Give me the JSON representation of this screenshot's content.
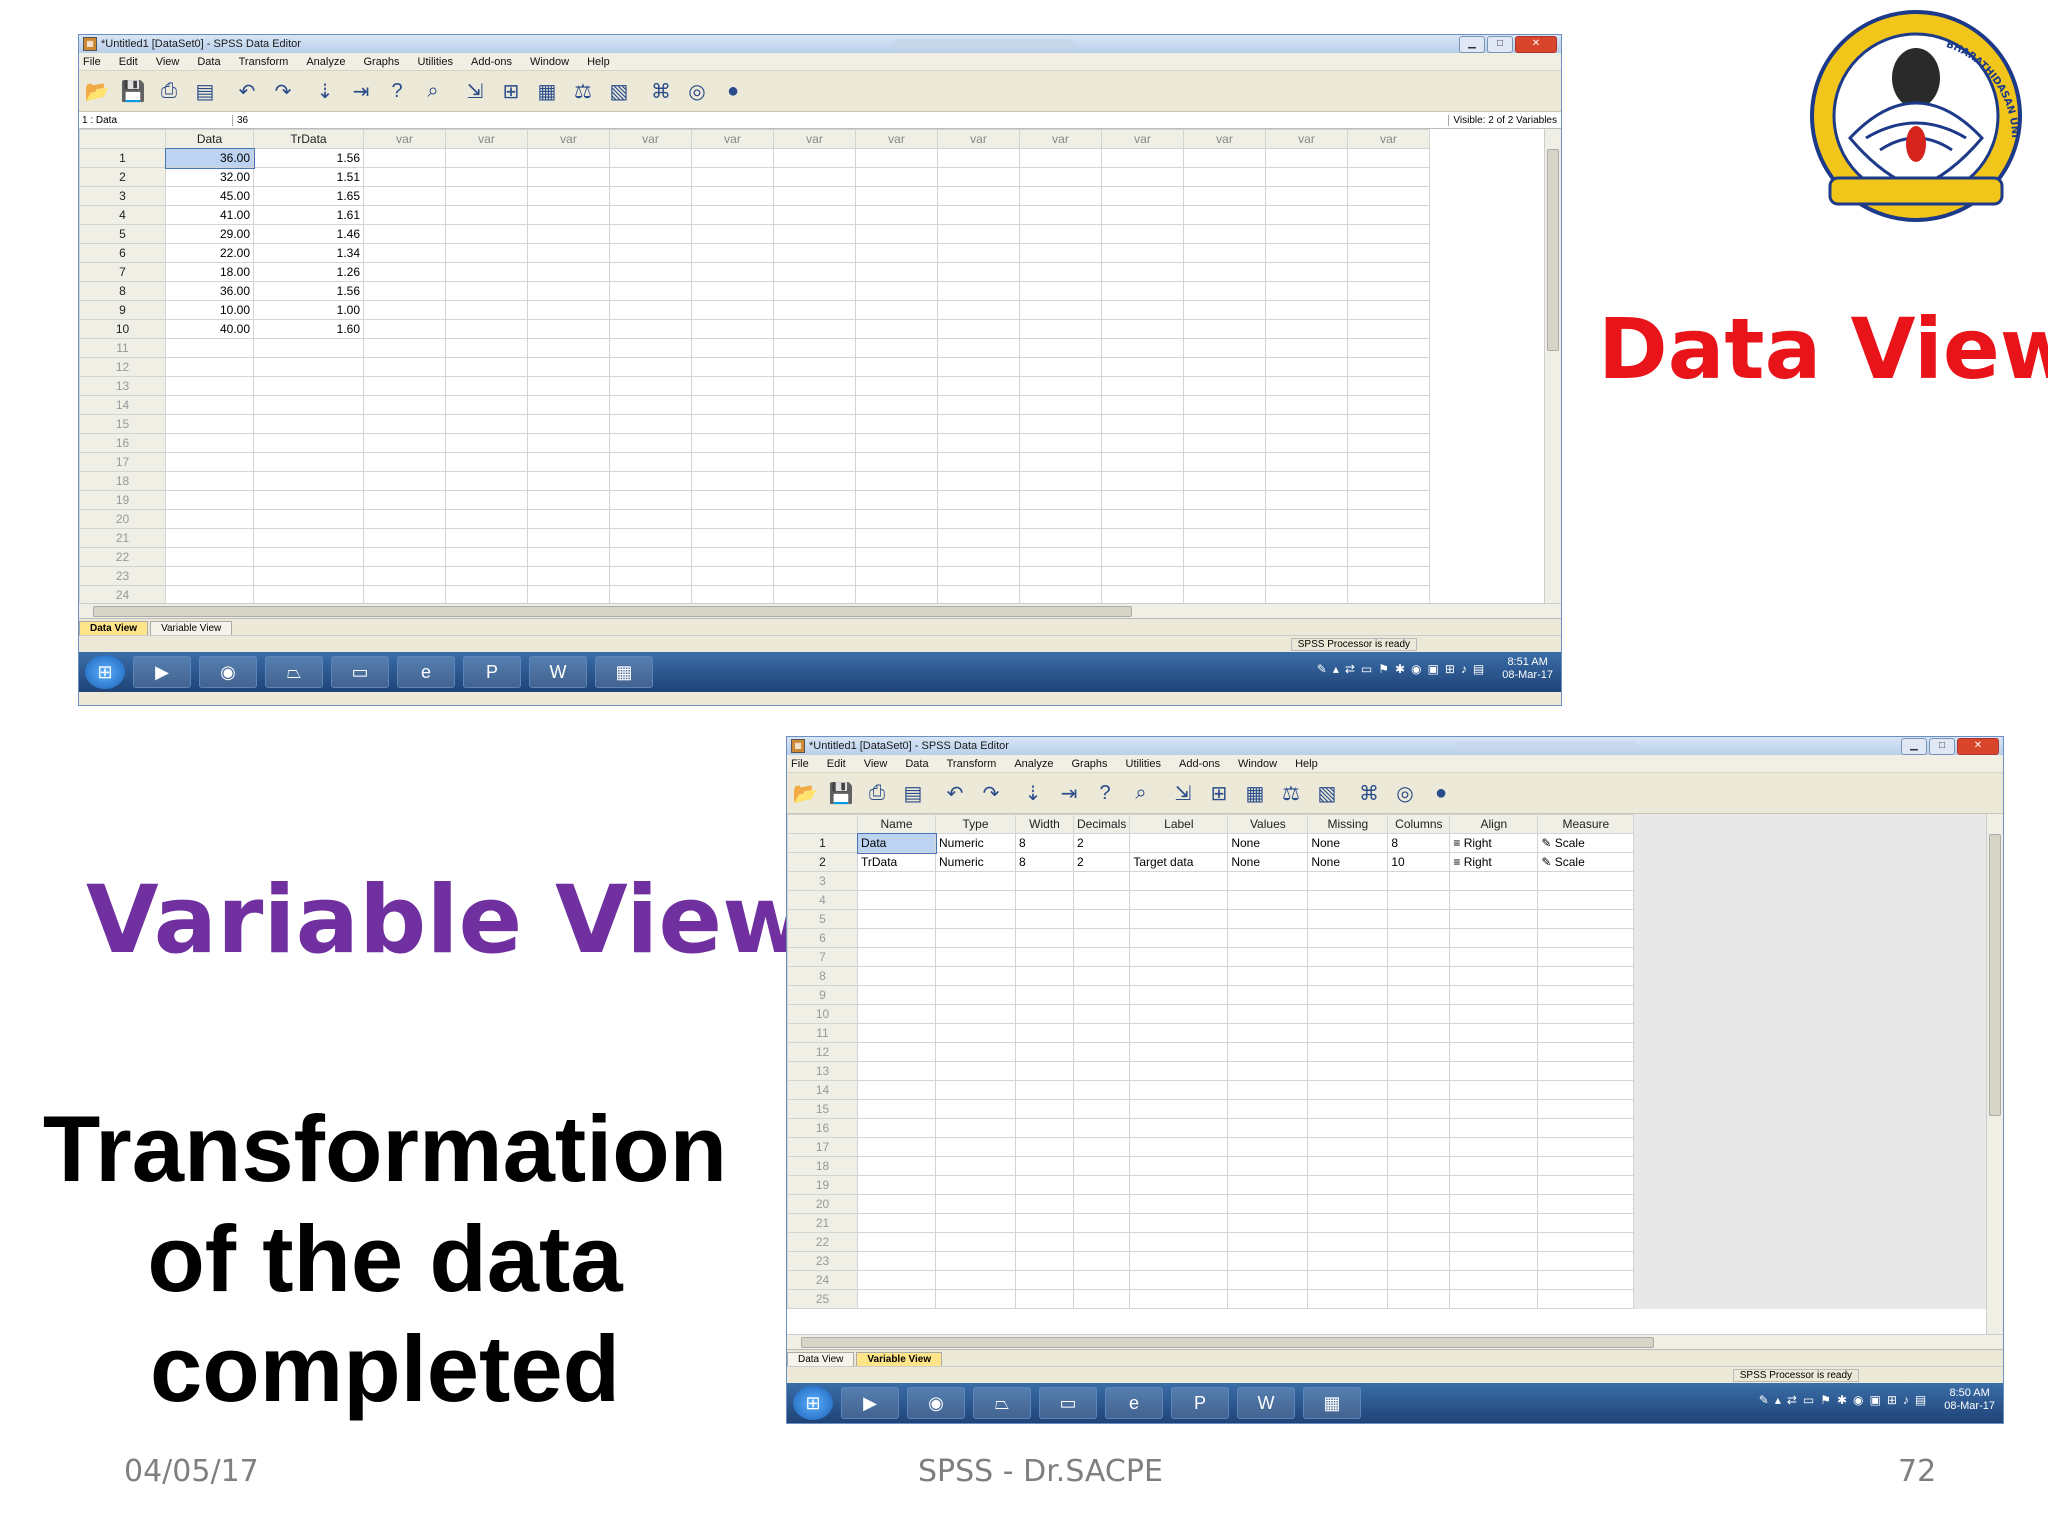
{
  "slide": {
    "data_view_heading": "Data View",
    "variable_view_heading": "Variable View",
    "transform_lines": [
      "Transformation",
      "of the data",
      "completed"
    ],
    "footer_date": "04/05/17",
    "footer_center": "SPSS - Dr.SACPE",
    "footer_page": "72",
    "logo_text": "BHARATHIDASAN UNIVERSITY"
  },
  "window1": {
    "title": "*Untitled1 [DataSet0] - SPSS Data Editor",
    "menu": [
      "File",
      "Edit",
      "View",
      "Data",
      "Transform",
      "Analyze",
      "Graphs",
      "Utilities",
      "Add-ons",
      "Window",
      "Help"
    ],
    "cell_ref": "1 : Data",
    "cell_value": "36",
    "visible": "Visible: 2 of 2 Variables",
    "columns": [
      "Data",
      "TrData",
      "var",
      "var",
      "var",
      "var",
      "var",
      "var",
      "var",
      "var",
      "var",
      "var",
      "var",
      "var",
      "var"
    ],
    "rows": [
      [
        "36.00",
        "1.56"
      ],
      [
        "32.00",
        "1.51"
      ],
      [
        "45.00",
        "1.65"
      ],
      [
        "41.00",
        "1.61"
      ],
      [
        "29.00",
        "1.46"
      ],
      [
        "22.00",
        "1.34"
      ],
      [
        "18.00",
        "1.26"
      ],
      [
        "36.00",
        "1.56"
      ],
      [
        "10.00",
        "1.00"
      ],
      [
        "40.00",
        "1.60"
      ]
    ],
    "row_count": 24,
    "tabs": [
      "Data View",
      "Variable View"
    ],
    "status": "SPSS  Processor is ready",
    "clock_time": "8:51 AM",
    "clock_date": "08-Mar-17"
  },
  "window2": {
    "title": "*Untitled1 [DataSet0] - SPSS Data Editor",
    "menu": [
      "File",
      "Edit",
      "View",
      "Data",
      "Transform",
      "Analyze",
      "Graphs",
      "Utilities",
      "Add-ons",
      "Window",
      "Help"
    ],
    "columns": [
      "Name",
      "Type",
      "Width",
      "Decimals",
      "Label",
      "Values",
      "Missing",
      "Columns",
      "Align",
      "Measure"
    ],
    "rows": [
      [
        "Data",
        "Numeric",
        "8",
        "2",
        "",
        "None",
        "None",
        "8",
        "Right",
        "Scale"
      ],
      [
        "TrData",
        "Numeric",
        "8",
        "2",
        "Target data",
        "None",
        "None",
        "10",
        "Right",
        "Scale"
      ]
    ],
    "row_count": 25,
    "tabs": [
      "Data View",
      "Variable View"
    ],
    "status": "SPSS  Processor is ready",
    "clock_time": "8:50 AM",
    "clock_date": "08-Mar-17"
  },
  "icons": {
    "toolbar": [
      "open-folder-icon",
      "save-icon",
      "print-icon",
      "dialog-recall-icon",
      "undo-icon",
      "redo-icon",
      "goto-case-icon",
      "goto-variable-icon",
      "variables-icon",
      "find-icon",
      "insert-cases-icon",
      "insert-variable-icon",
      "split-file-icon",
      "weight-cases-icon",
      "select-cases-icon",
      "value-labels-icon",
      "use-sets-icon",
      "show-all-icon"
    ],
    "taskbar": [
      "start-orb-icon",
      "media-player-icon",
      "firefox-icon",
      "acrobat-icon",
      "file-explorer-icon",
      "internet-explorer-icon",
      "powerpoint-icon",
      "word-icon",
      "spss-icon"
    ]
  },
  "colors": {
    "data_view_heading": "#e8141a",
    "variable_view_heading": "#7030a0",
    "active_tab": "#ffe58a",
    "selected_cell": "#bcd4f2"
  }
}
